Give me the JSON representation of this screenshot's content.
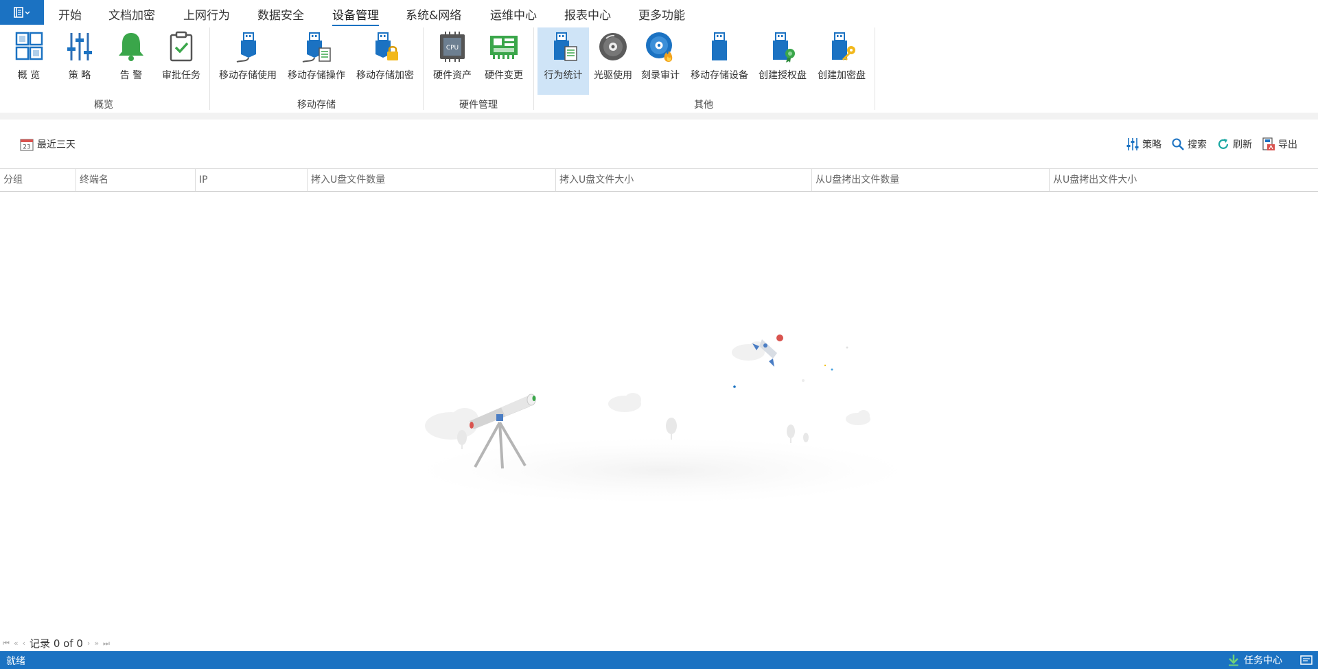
{
  "menubar": {
    "items": [
      "开始",
      "文档加密",
      "上网行为",
      "数据安全",
      "设备管理",
      "系统&网络",
      "运维中心",
      "报表中心",
      "更多功能"
    ],
    "active": "设备管理"
  },
  "ribbon": {
    "groups": [
      {
        "label": "概览",
        "buttons": [
          "概 览",
          "策 略",
          "告 警",
          "审批任务"
        ]
      },
      {
        "label": "移动存储",
        "buttons": [
          "移动存储使用",
          "移动存储操作",
          "移动存储加密"
        ]
      },
      {
        "label": "硬件管理",
        "buttons": [
          "硬件资产",
          "硬件变更"
        ]
      },
      {
        "label": "其他",
        "buttons": [
          "行为统计",
          "光驱使用",
          "刻录审计",
          "移动存储设备",
          "创建授权盘",
          "创建加密盘"
        ]
      }
    ],
    "selected": "行为统计",
    "hardware_chip_text": "CPU"
  },
  "toolbar": {
    "date_range": "最近三天",
    "calendar_day": "23",
    "policy": "策略",
    "search": "搜索",
    "refresh": "刷新",
    "export": "导出"
  },
  "grid": {
    "columns": [
      "分组",
      "终端名",
      "IP",
      "拷入U盘文件数量",
      "拷入U盘文件大小",
      "从U盘拷出文件数量",
      "从U盘拷出文件大小"
    ],
    "rows": []
  },
  "pager": {
    "record_text": "记录 0 of 0"
  },
  "statusbar": {
    "status": "就绪",
    "task_center": "任务中心"
  },
  "colors": {
    "accent": "#1b72c2",
    "selected_bg": "#cfe4f7",
    "icon_green": "#3aa64a"
  }
}
